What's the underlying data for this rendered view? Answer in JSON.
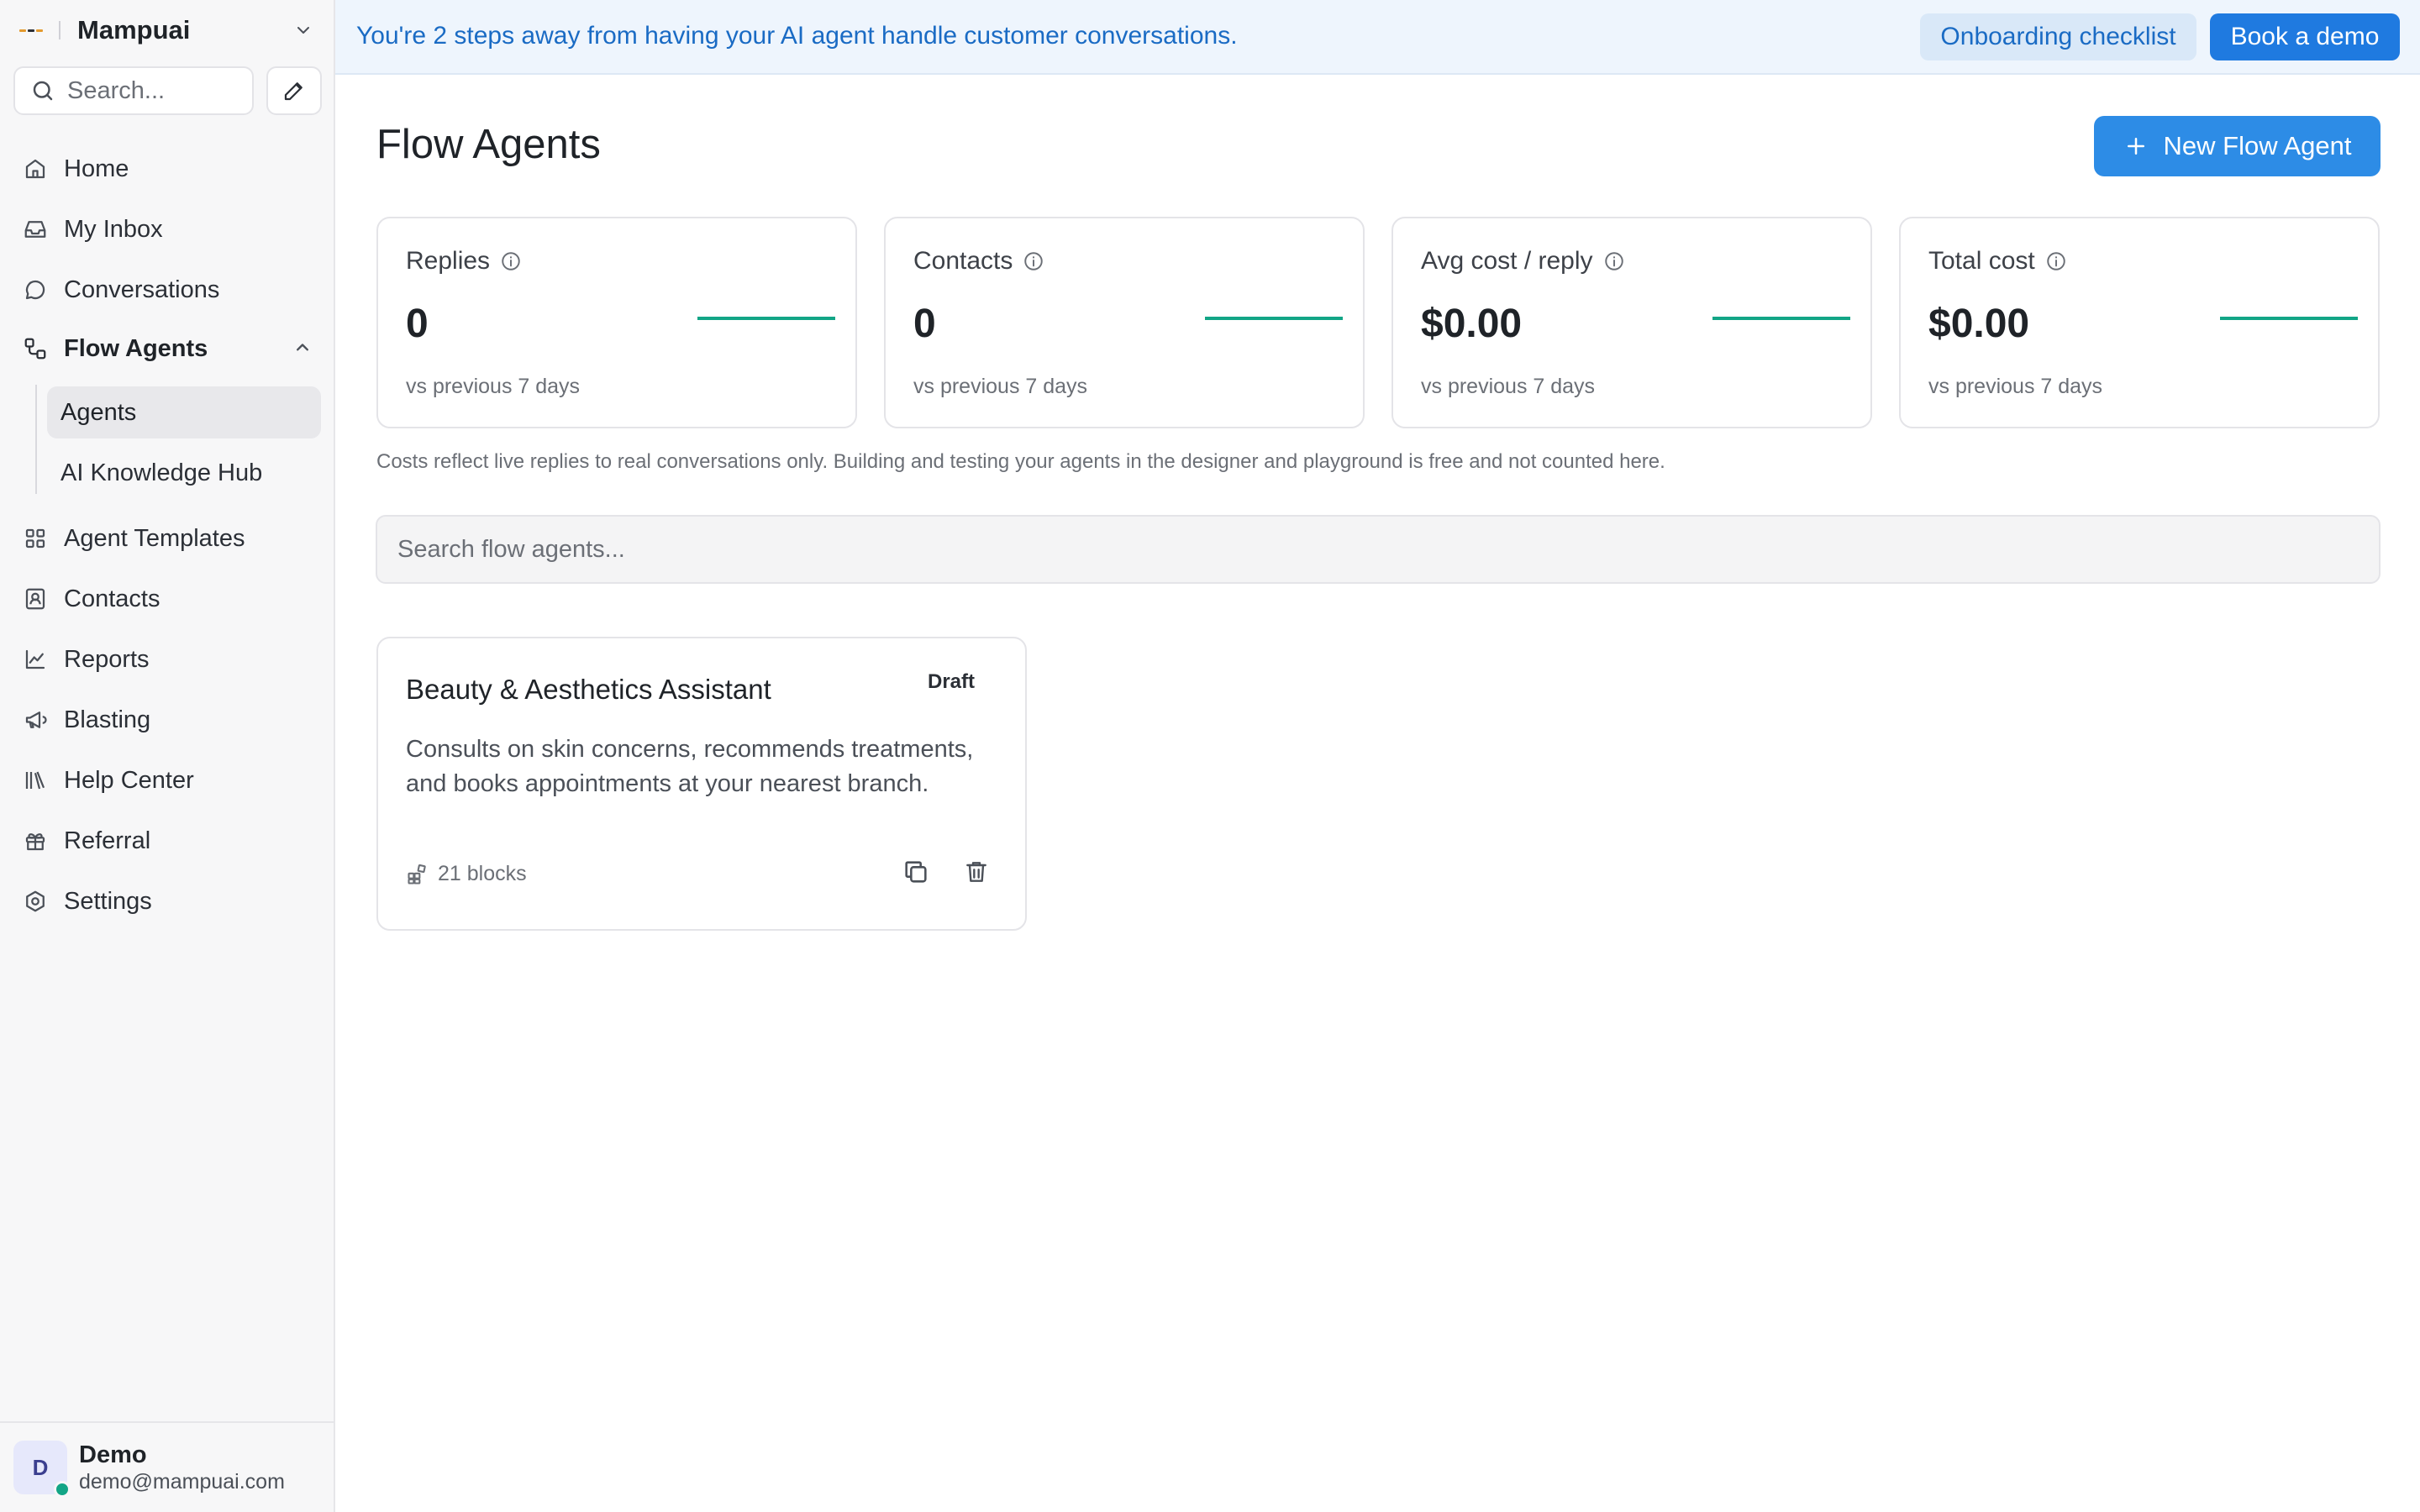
{
  "workspace": {
    "name": "Mampuai"
  },
  "sidebar": {
    "search_placeholder": "Search...",
    "nav": {
      "home": "Home",
      "inbox": "My Inbox",
      "conversations": "Conversations",
      "flow_agents": "Flow Agents",
      "agents": "Agents",
      "knowledge_hub": "AI Knowledge Hub",
      "agent_templates": "Agent Templates",
      "contacts": "Contacts",
      "reports": "Reports",
      "blasting": "Blasting",
      "help_center": "Help Center",
      "referral": "Referral",
      "settings": "Settings"
    },
    "user": {
      "initial": "D",
      "name": "Demo",
      "email": "demo@mampuai.com"
    }
  },
  "banner": {
    "text": "You're 2 steps away from having your AI agent handle customer conversations.",
    "checklist_label": "Onboarding checklist",
    "demo_label": "Book a demo"
  },
  "main": {
    "title": "Flow Agents",
    "new_button": "New Flow Agent",
    "stats": [
      {
        "label": "Replies",
        "value": "0",
        "sub": "vs previous 7 days"
      },
      {
        "label": "Contacts",
        "value": "0",
        "sub": "vs previous 7 days"
      },
      {
        "label": "Avg cost / reply",
        "value": "$0.00",
        "sub": "vs previous 7 days"
      },
      {
        "label": "Total cost",
        "value": "$0.00",
        "sub": "vs previous 7 days"
      }
    ],
    "cost_note": "Costs reflect live replies to real conversations only. Building and testing your agents in the designer and playground is free and not counted here.",
    "search_placeholder": "Search flow agents...",
    "agents": [
      {
        "title": "Beauty & Aesthetics Assistant",
        "badge": "Draft",
        "description": "Consults on skin concerns, recommends treatments, and books appointments at your nearest branch.",
        "blocks": "21 blocks"
      }
    ]
  },
  "colors": {
    "accent": "#2d8ce6",
    "banner_bg": "#eef5fd",
    "banner_text": "#1a6bc4",
    "sparkline": "#12a586",
    "status_online": "#12a586"
  }
}
